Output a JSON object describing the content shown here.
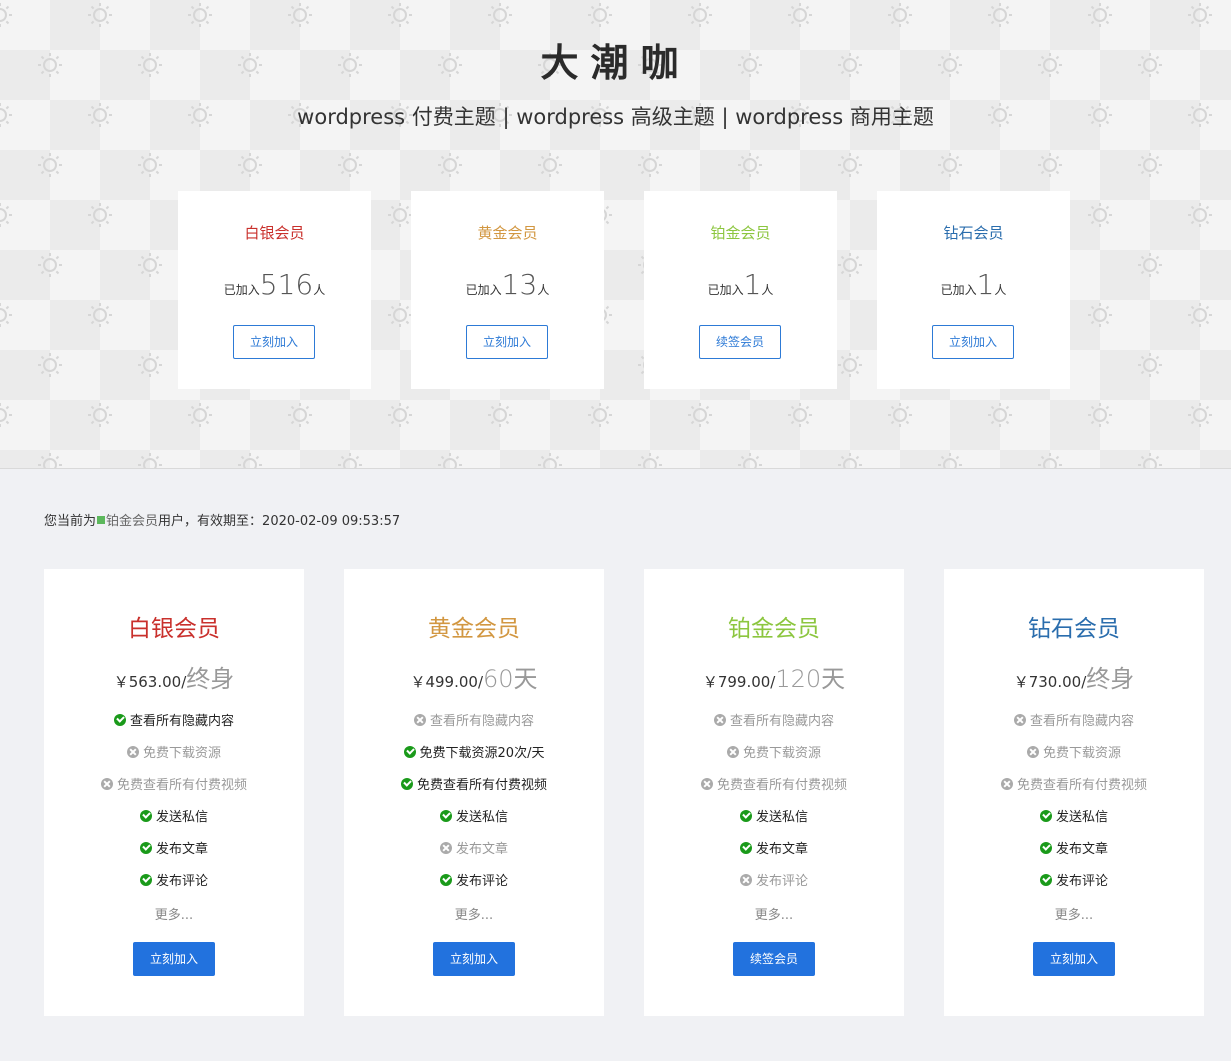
{
  "header": {
    "title": "大潮咖",
    "subtitle": "wordpress 付费主题 | wordpress 高级主题 | wordpress 商用主题"
  },
  "colors": {
    "silver": "#c9302c",
    "gold": "#d29741",
    "platinum": "#8cc63f",
    "diamond": "#2a6dad",
    "primary_button": "#2272de",
    "outline_button": "#2d7ad6",
    "ok_icon": "#1a9a1a",
    "no_icon": "#aaaaaa"
  },
  "summary_cards": [
    {
      "name": "白银会员",
      "prefix": "已加入",
      "count": "516",
      "suffix": "人",
      "button": "立刻加入"
    },
    {
      "name": "黄金会员",
      "prefix": "已加入",
      "count": "13",
      "suffix": "人",
      "button": "立刻加入"
    },
    {
      "name": "铂金会员",
      "prefix": "已加入",
      "count": "1",
      "suffix": "人",
      "button": "续签会员"
    },
    {
      "name": "钻石会员",
      "prefix": "已加入",
      "count": "1",
      "suffix": "人",
      "button": "立刻加入"
    }
  ],
  "status": {
    "prefix": "您当前为",
    "level": "铂金会员",
    "middle": "用户，有效期至：",
    "expiry": "2020-02-09 09:53:57"
  },
  "plans": [
    {
      "name": "白银会员",
      "price": "￥563.00/",
      "duration": "终身",
      "features": [
        {
          "text": "查看所有隐藏内容",
          "ok": true,
          "icon": "check-circle-icon"
        },
        {
          "text": "免费下载资源",
          "ok": false,
          "icon": "x-circle-icon"
        },
        {
          "text": "免费查看所有付费视频",
          "ok": false,
          "icon": "x-circle-icon"
        },
        {
          "text": "发送私信",
          "ok": true,
          "icon": "check-circle-icon"
        },
        {
          "text": "发布文章",
          "ok": true,
          "icon": "check-circle-icon"
        },
        {
          "text": "发布评论",
          "ok": true,
          "icon": "check-circle-icon"
        }
      ],
      "more": "更多...",
      "button": "立刻加入"
    },
    {
      "name": "黄金会员",
      "price": "￥499.00/",
      "duration": "60天",
      "features": [
        {
          "text": "查看所有隐藏内容",
          "ok": false,
          "icon": "x-circle-icon"
        },
        {
          "text": "免费下载资源20次/天",
          "ok": true,
          "icon": "check-circle-icon"
        },
        {
          "text": "免费查看所有付费视频",
          "ok": true,
          "icon": "check-circle-icon"
        },
        {
          "text": "发送私信",
          "ok": true,
          "icon": "check-circle-icon"
        },
        {
          "text": "发布文章",
          "ok": false,
          "icon": "x-circle-icon"
        },
        {
          "text": "发布评论",
          "ok": true,
          "icon": "check-circle-icon"
        }
      ],
      "more": "更多...",
      "button": "立刻加入"
    },
    {
      "name": "铂金会员",
      "price": "￥799.00/",
      "duration": "120天",
      "features": [
        {
          "text": "查看所有隐藏内容",
          "ok": false,
          "icon": "x-circle-icon"
        },
        {
          "text": "免费下载资源",
          "ok": false,
          "icon": "x-circle-icon"
        },
        {
          "text": "免费查看所有付费视频",
          "ok": false,
          "icon": "x-circle-icon"
        },
        {
          "text": "发送私信",
          "ok": true,
          "icon": "check-circle-icon"
        },
        {
          "text": "发布文章",
          "ok": true,
          "icon": "check-circle-icon"
        },
        {
          "text": "发布评论",
          "ok": false,
          "icon": "x-circle-icon"
        }
      ],
      "more": "更多...",
      "button": "续签会员"
    },
    {
      "name": "钻石会员",
      "price": "￥730.00/",
      "duration": "终身",
      "features": [
        {
          "text": "查看所有隐藏内容",
          "ok": false,
          "icon": "x-circle-icon"
        },
        {
          "text": "免费下载资源",
          "ok": false,
          "icon": "x-circle-icon"
        },
        {
          "text": "免费查看所有付费视频",
          "ok": false,
          "icon": "x-circle-icon"
        },
        {
          "text": "发送私信",
          "ok": true,
          "icon": "check-circle-icon"
        },
        {
          "text": "发布文章",
          "ok": true,
          "icon": "check-circle-icon"
        },
        {
          "text": "发布评论",
          "ok": true,
          "icon": "check-circle-icon"
        }
      ],
      "more": "更多...",
      "button": "立刻加入"
    }
  ]
}
